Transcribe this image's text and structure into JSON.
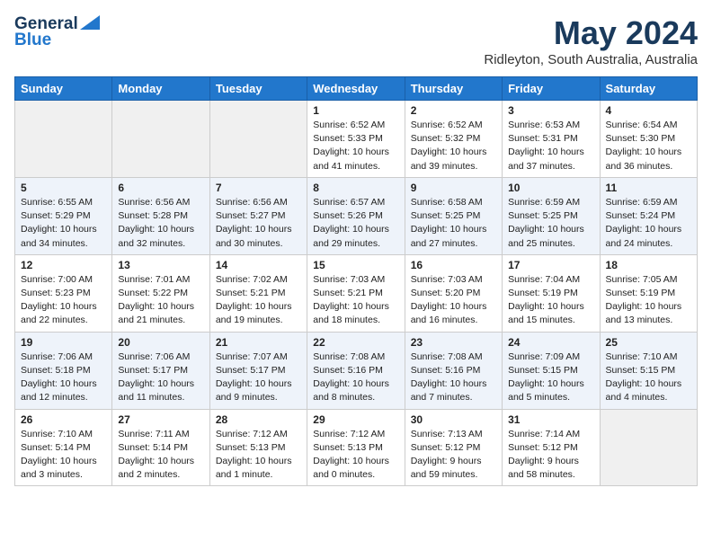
{
  "header": {
    "logo_line1": "General",
    "logo_line2": "Blue",
    "month": "May 2024",
    "location": "Ridleyton, South Australia, Australia"
  },
  "days_of_week": [
    "Sunday",
    "Monday",
    "Tuesday",
    "Wednesday",
    "Thursday",
    "Friday",
    "Saturday"
  ],
  "weeks": [
    [
      {
        "day": "",
        "info": ""
      },
      {
        "day": "",
        "info": ""
      },
      {
        "day": "",
        "info": ""
      },
      {
        "day": "1",
        "info": "Sunrise: 6:52 AM\nSunset: 5:33 PM\nDaylight: 10 hours\nand 41 minutes."
      },
      {
        "day": "2",
        "info": "Sunrise: 6:52 AM\nSunset: 5:32 PM\nDaylight: 10 hours\nand 39 minutes."
      },
      {
        "day": "3",
        "info": "Sunrise: 6:53 AM\nSunset: 5:31 PM\nDaylight: 10 hours\nand 37 minutes."
      },
      {
        "day": "4",
        "info": "Sunrise: 6:54 AM\nSunset: 5:30 PM\nDaylight: 10 hours\nand 36 minutes."
      }
    ],
    [
      {
        "day": "5",
        "info": "Sunrise: 6:55 AM\nSunset: 5:29 PM\nDaylight: 10 hours\nand 34 minutes."
      },
      {
        "day": "6",
        "info": "Sunrise: 6:56 AM\nSunset: 5:28 PM\nDaylight: 10 hours\nand 32 minutes."
      },
      {
        "day": "7",
        "info": "Sunrise: 6:56 AM\nSunset: 5:27 PM\nDaylight: 10 hours\nand 30 minutes."
      },
      {
        "day": "8",
        "info": "Sunrise: 6:57 AM\nSunset: 5:26 PM\nDaylight: 10 hours\nand 29 minutes."
      },
      {
        "day": "9",
        "info": "Sunrise: 6:58 AM\nSunset: 5:25 PM\nDaylight: 10 hours\nand 27 minutes."
      },
      {
        "day": "10",
        "info": "Sunrise: 6:59 AM\nSunset: 5:25 PM\nDaylight: 10 hours\nand 25 minutes."
      },
      {
        "day": "11",
        "info": "Sunrise: 6:59 AM\nSunset: 5:24 PM\nDaylight: 10 hours\nand 24 minutes."
      }
    ],
    [
      {
        "day": "12",
        "info": "Sunrise: 7:00 AM\nSunset: 5:23 PM\nDaylight: 10 hours\nand 22 minutes."
      },
      {
        "day": "13",
        "info": "Sunrise: 7:01 AM\nSunset: 5:22 PM\nDaylight: 10 hours\nand 21 minutes."
      },
      {
        "day": "14",
        "info": "Sunrise: 7:02 AM\nSunset: 5:21 PM\nDaylight: 10 hours\nand 19 minutes."
      },
      {
        "day": "15",
        "info": "Sunrise: 7:03 AM\nSunset: 5:21 PM\nDaylight: 10 hours\nand 18 minutes."
      },
      {
        "day": "16",
        "info": "Sunrise: 7:03 AM\nSunset: 5:20 PM\nDaylight: 10 hours\nand 16 minutes."
      },
      {
        "day": "17",
        "info": "Sunrise: 7:04 AM\nSunset: 5:19 PM\nDaylight: 10 hours\nand 15 minutes."
      },
      {
        "day": "18",
        "info": "Sunrise: 7:05 AM\nSunset: 5:19 PM\nDaylight: 10 hours\nand 13 minutes."
      }
    ],
    [
      {
        "day": "19",
        "info": "Sunrise: 7:06 AM\nSunset: 5:18 PM\nDaylight: 10 hours\nand 12 minutes."
      },
      {
        "day": "20",
        "info": "Sunrise: 7:06 AM\nSunset: 5:17 PM\nDaylight: 10 hours\nand 11 minutes."
      },
      {
        "day": "21",
        "info": "Sunrise: 7:07 AM\nSunset: 5:17 PM\nDaylight: 10 hours\nand 9 minutes."
      },
      {
        "day": "22",
        "info": "Sunrise: 7:08 AM\nSunset: 5:16 PM\nDaylight: 10 hours\nand 8 minutes."
      },
      {
        "day": "23",
        "info": "Sunrise: 7:08 AM\nSunset: 5:16 PM\nDaylight: 10 hours\nand 7 minutes."
      },
      {
        "day": "24",
        "info": "Sunrise: 7:09 AM\nSunset: 5:15 PM\nDaylight: 10 hours\nand 5 minutes."
      },
      {
        "day": "25",
        "info": "Sunrise: 7:10 AM\nSunset: 5:15 PM\nDaylight: 10 hours\nand 4 minutes."
      }
    ],
    [
      {
        "day": "26",
        "info": "Sunrise: 7:10 AM\nSunset: 5:14 PM\nDaylight: 10 hours\nand 3 minutes."
      },
      {
        "day": "27",
        "info": "Sunrise: 7:11 AM\nSunset: 5:14 PM\nDaylight: 10 hours\nand 2 minutes."
      },
      {
        "day": "28",
        "info": "Sunrise: 7:12 AM\nSunset: 5:13 PM\nDaylight: 10 hours\nand 1 minute."
      },
      {
        "day": "29",
        "info": "Sunrise: 7:12 AM\nSunset: 5:13 PM\nDaylight: 10 hours\nand 0 minutes."
      },
      {
        "day": "30",
        "info": "Sunrise: 7:13 AM\nSunset: 5:12 PM\nDaylight: 9 hours\nand 59 minutes."
      },
      {
        "day": "31",
        "info": "Sunrise: 7:14 AM\nSunset: 5:12 PM\nDaylight: 9 hours\nand 58 minutes."
      },
      {
        "day": "",
        "info": ""
      }
    ]
  ]
}
